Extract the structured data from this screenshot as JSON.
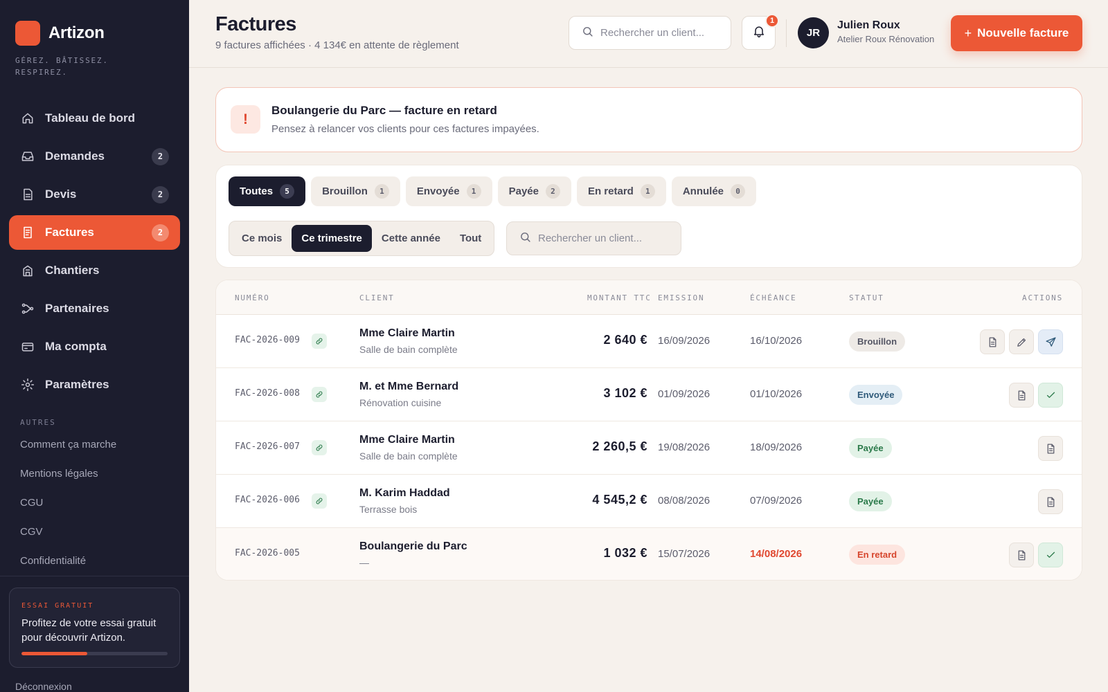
{
  "app": {
    "name": "Artizon",
    "tagline": "GÉREZ. BÂTISSEZ. RESPIREZ.",
    "accent": "#ec5836",
    "sidebar_bg": "#1c1d2e"
  },
  "sidebar": {
    "items": [
      {
        "label": "Tableau de bord",
        "icon": "home-icon",
        "badge": ""
      },
      {
        "label": "Demandes",
        "icon": "inbox-icon",
        "badge": "2"
      },
      {
        "label": "Devis",
        "icon": "document-icon",
        "badge": "2"
      },
      {
        "label": "Factures",
        "icon": "invoice-icon",
        "badge": "2",
        "active": true
      },
      {
        "label": "Chantiers",
        "icon": "building-icon",
        "badge": ""
      },
      {
        "label": "Partenaires",
        "icon": "network-icon",
        "badge": ""
      },
      {
        "label": "Ma compta",
        "icon": "card-icon",
        "badge": ""
      },
      {
        "label": "Paramètres",
        "icon": "gear-icon",
        "badge": ""
      }
    ],
    "others_title": "AUTRES",
    "others": [
      "Comment ça marche",
      "Mentions légales",
      "CGU",
      "CGV",
      "Confidentialité"
    ],
    "trial": {
      "title": "ESSAI GRATUIT",
      "text": "Profitez de votre essai gratuit pour découvrir Artizon.",
      "progress": 0.45
    },
    "logout": "Déconnexion"
  },
  "header": {
    "title": "Factures",
    "subtitle": "9 factures affichées · 4 134€ en attente de règlement",
    "search_placeholder": "Rechercher un client...",
    "notifications": "1",
    "user": {
      "initials": "JR",
      "name": "Julien Roux",
      "company": "Atelier Roux Rénovation"
    },
    "new_invoice": "Nouvelle facture",
    "new_invoice_plus": "+"
  },
  "alert": {
    "icon": "!",
    "title": "Boulangerie du Parc — facture en retard",
    "text": "Pensez à relancer vos clients pour ces factures impayées."
  },
  "filters": {
    "status_tabs": [
      {
        "label": "Toutes",
        "count": "5",
        "active": true
      },
      {
        "label": "Brouillon",
        "count": "1"
      },
      {
        "label": "Envoyée",
        "count": "1"
      },
      {
        "label": "Payée",
        "count": "2"
      },
      {
        "label": "En retard",
        "count": "1"
      },
      {
        "label": "Annulée",
        "count": "0"
      }
    ],
    "periods": [
      {
        "label": "Ce mois"
      },
      {
        "label": "Ce trimestre",
        "active": true
      },
      {
        "label": "Cette année"
      },
      {
        "label": "Tout"
      }
    ],
    "search_placeholder": "Rechercher un client..."
  },
  "table": {
    "headers": {
      "number": "NUMÉRO",
      "client": "CLIENT",
      "amount": "MONTANT TTC",
      "emission": "EMISSION",
      "due": "ÉCHÉANCE",
      "status": "STATUT",
      "actions": "ACTIONS"
    },
    "rows": [
      {
        "number": "FAC-2026-009",
        "linked": true,
        "client": "Mme Claire Martin",
        "desc": "Salle de bain complète",
        "amount": "2 640 €",
        "emission": "16/09/2026",
        "due": "16/10/2026",
        "due_late": false,
        "status": "Brouillon",
        "status_class": "brouillon",
        "actions": [
          "pdf",
          "edit",
          "send"
        ]
      },
      {
        "number": "FAC-2026-008",
        "linked": true,
        "client": "M. et Mme Bernard",
        "desc": "Rénovation cuisine",
        "amount": "3 102 €",
        "emission": "01/09/2026",
        "due": "01/10/2026",
        "due_late": false,
        "status": "Envoyée",
        "status_class": "envoyee",
        "actions": [
          "pdf",
          "paid"
        ]
      },
      {
        "number": "FAC-2026-007",
        "linked": true,
        "client": "Mme Claire Martin",
        "desc": "Salle de bain complète",
        "amount": "2 260,5 €",
        "emission": "19/08/2026",
        "due": "18/09/2026",
        "due_late": false,
        "status": "Payée",
        "status_class": "payee",
        "actions": [
          "pdf"
        ]
      },
      {
        "number": "FAC-2026-006",
        "linked": true,
        "client": "M. Karim Haddad",
        "desc": "Terrasse bois",
        "amount": "4 545,2 €",
        "emission": "08/08/2026",
        "due": "07/09/2026",
        "due_late": false,
        "status": "Payée",
        "status_class": "payee",
        "actions": [
          "pdf"
        ]
      },
      {
        "number": "FAC-2026-005",
        "linked": false,
        "client": "Boulangerie du Parc",
        "desc": "—",
        "amount": "1 032 €",
        "emission": "15/07/2026",
        "due": "14/08/2026",
        "due_late": true,
        "status": "En retard",
        "status_class": "retard",
        "actions": [
          "pdf",
          "paid"
        ]
      }
    ]
  }
}
